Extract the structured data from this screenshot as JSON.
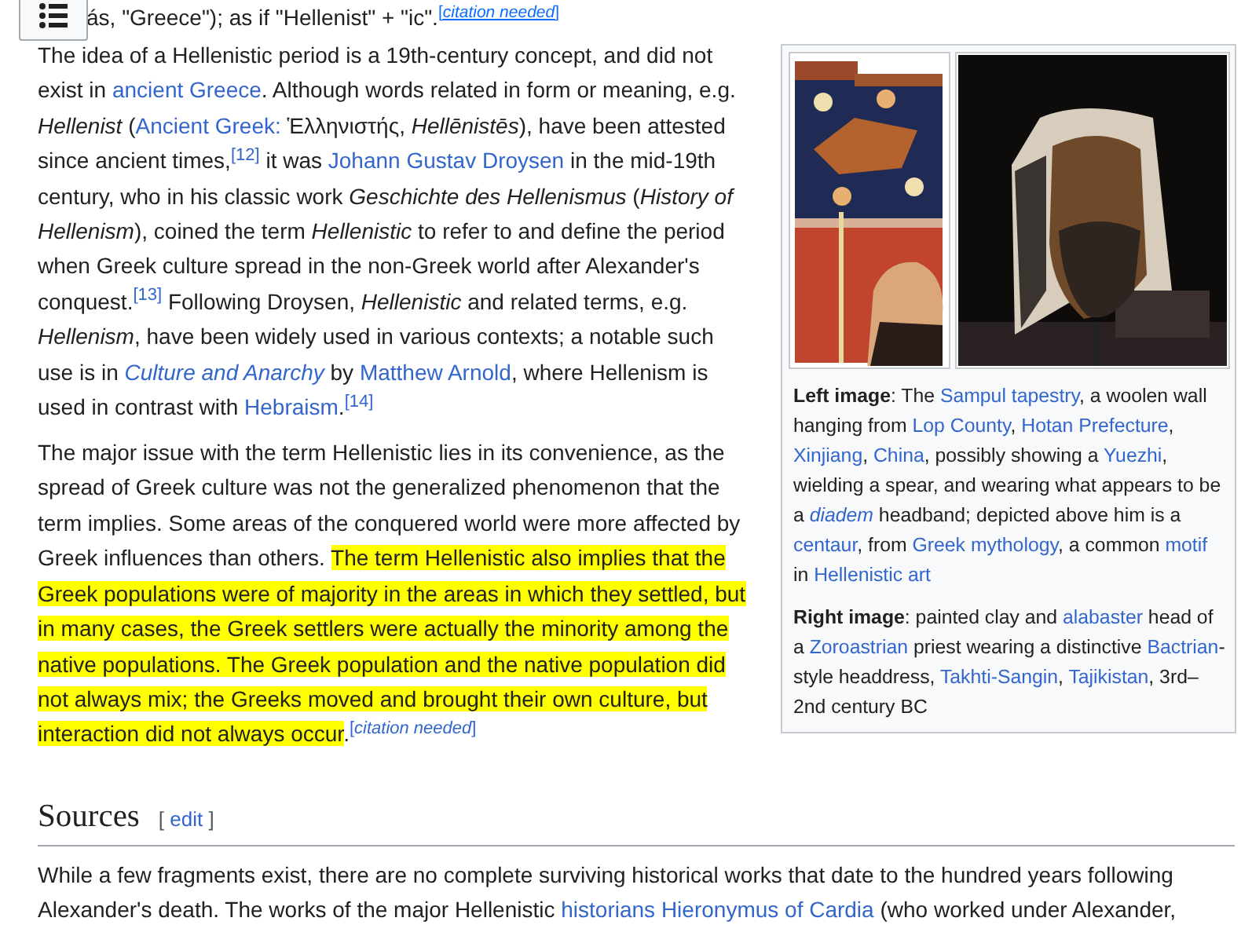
{
  "toc_button": {
    "kind": "list"
  },
  "lead_line": [
    {
      "kind": "text",
      "text": "ás, \"Greece\"); as if \"Hellenist\" + \"ic\"."
    },
    {
      "kind": "cite",
      "text": "[*citation needed*]"
    }
  ],
  "infobox": {
    "caption": [
      [
        {
          "kind": "text",
          "text": "**Left image**: The "
        },
        {
          "kind": "link",
          "text": "Sampul tapestry"
        },
        {
          "kind": "text",
          "text": ", a woolen wall hanging from "
        },
        {
          "kind": "link",
          "text": "Lop County"
        },
        {
          "kind": "text",
          "text": ", "
        },
        {
          "kind": "link",
          "text": "Hotan Prefecture"
        },
        {
          "kind": "text",
          "text": ", "
        },
        {
          "kind": "link",
          "text": "Xinjiang"
        },
        {
          "kind": "text",
          "text": ", "
        },
        {
          "kind": "link",
          "text": "China"
        },
        {
          "kind": "text",
          "text": ", possibly showing a "
        },
        {
          "kind": "link",
          "text": "Yuezhi"
        },
        {
          "kind": "text",
          "text": ", wielding a spear, and wearing what appears to be a "
        },
        {
          "kind": "link",
          "text": "*diadem*"
        },
        {
          "kind": "text",
          "text": " headband; depicted above him is a "
        },
        {
          "kind": "link",
          "text": "centaur"
        },
        {
          "kind": "text",
          "text": ", from "
        },
        {
          "kind": "link",
          "text": "Greek mythology"
        },
        {
          "kind": "text",
          "text": ", a common "
        },
        {
          "kind": "link",
          "text": "motif"
        },
        {
          "kind": "text",
          "text": " in "
        },
        {
          "kind": "link",
          "text": "Hellenistic art"
        }
      ],
      [
        {
          "kind": "text",
          "text": "**Right image**: painted clay and "
        },
        {
          "kind": "link",
          "text": "alabaster"
        },
        {
          "kind": "text",
          "text": " head of a "
        },
        {
          "kind": "link",
          "text": "Zoroastrian"
        },
        {
          "kind": "text",
          "text": " priest wearing a distinctive "
        },
        {
          "kind": "link",
          "text": "Bactrian"
        },
        {
          "kind": "text",
          "text": "-style headdress, "
        },
        {
          "kind": "link",
          "text": "Takhti-Sangin"
        },
        {
          "kind": "text",
          "text": ", "
        },
        {
          "kind": "link",
          "text": "Tajikistan"
        },
        {
          "kind": "text",
          "text": ", 3rd–2nd century BC"
        }
      ]
    ]
  },
  "paragraphs": [
    [
      {
        "kind": "text",
        "text": "The idea of a Hellenistic period is a 19th-century concept, and did not exist in "
      },
      {
        "kind": "link",
        "text": "ancient Greece"
      },
      {
        "kind": "text",
        "text": ". Although words related in form or meaning, e.g. *Hellenist* ("
      },
      {
        "kind": "link",
        "text": "Ancient Greek:"
      },
      {
        "kind": "text",
        "text": " Ἑλληνιστής, *Hellēnistēs*), have been attested since ancient times,"
      },
      {
        "kind": "ref",
        "text": "[12]"
      },
      {
        "kind": "text",
        "text": " it was "
      },
      {
        "kind": "link",
        "text": "Johann Gustav Droysen"
      },
      {
        "kind": "text",
        "text": " in the mid-19th century, who in his classic work *Geschichte des Hellenismus* (*History of Hellenism*), coined the term *Hellenistic* to refer to and define the period when Greek culture spread in the non-Greek world after Alexander's conquest."
      },
      {
        "kind": "ref",
        "text": "[13]"
      },
      {
        "kind": "text",
        "text": " Following Droysen, *Hellenistic* and related terms, e.g. *Hellenism*, have been widely used in various contexts; a notable such use is in "
      },
      {
        "kind": "link",
        "text": "*Culture and Anarchy*"
      },
      {
        "kind": "text",
        "text": " by "
      },
      {
        "kind": "link",
        "text": "Matthew Arnold"
      },
      {
        "kind": "text",
        "text": ", where Hellenism is used in contrast with "
      },
      {
        "kind": "link",
        "text": "Hebraism"
      },
      {
        "kind": "text",
        "text": "."
      },
      {
        "kind": "ref",
        "text": "[14]"
      }
    ],
    [
      {
        "kind": "text",
        "text": "The major issue with the term Hellenistic lies in its convenience, as the spread of Greek culture was not the generalized phenomenon that the term implies. Some areas of the conquered world were more affected by Greek influences than others. "
      },
      {
        "kind": "highlight",
        "text": "The term Hellenistic also implies that the Greek populations were of majority in the areas in which they settled, but in many cases, the Greek settlers were actually the minority among the native populations. The Greek population and the native population did not always mix; the Greeks moved and brought their own culture, but interaction did not always occur"
      },
      {
        "kind": "text",
        "text": "."
      },
      {
        "kind": "cite",
        "text": "[*citation needed*]"
      }
    ]
  ],
  "section": {
    "title": "Sources",
    "edit": {
      "open": "[",
      "label": "edit",
      "close": "]"
    }
  },
  "section_paragraphs": [
    [
      {
        "kind": "text",
        "text": "While a few fragments exist, there are no complete surviving historical works that date to the hundred years following Alexander's death. The works of the major Hellenistic "
      },
      {
        "kind": "link",
        "text": "historians Hieronymus of Cardia"
      },
      {
        "kind": "text",
        "text": " (who worked under Alexander,"
      }
    ]
  ]
}
